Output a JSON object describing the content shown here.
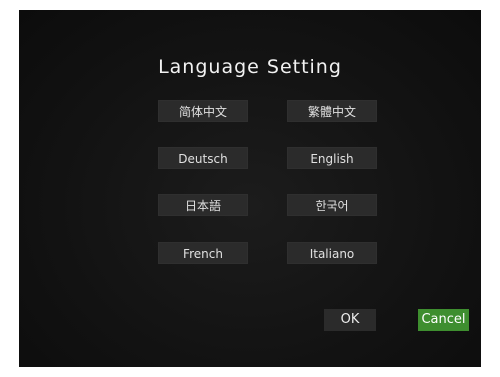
{
  "title": "Language Setting",
  "languages": [
    {
      "label": "简体中文"
    },
    {
      "label": "繁體中文"
    },
    {
      "label": "Deutsch"
    },
    {
      "label": "English"
    },
    {
      "label": "日本語"
    },
    {
      "label": "한국어"
    },
    {
      "label": "French"
    },
    {
      "label": "Italiano"
    }
  ],
  "actions": {
    "ok_label": "OK",
    "cancel_label": "Cancel"
  },
  "colors": {
    "cancel_accent": "#3e8e2f",
    "button_bg": "#2b2b2b",
    "screen_bg": "#121212"
  }
}
